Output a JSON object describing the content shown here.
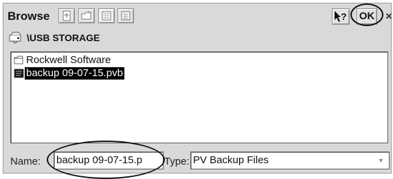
{
  "window": {
    "title": "Browse"
  },
  "toolbar": {
    "icons": [
      "document-up-icon",
      "folder-icon",
      "list-view-icon",
      "detail-view-icon"
    ],
    "help_label": "?",
    "ok_label": "OK",
    "close_label": "×"
  },
  "path": {
    "text": "\\USB STORAGE",
    "icon": "drive-icon"
  },
  "files": [
    {
      "label": "Rockwell Software",
      "icon": "folder-icon",
      "selected": false
    },
    {
      "label": "backup 09-07-15.pvb",
      "icon": "file-icon",
      "selected": true
    }
  ],
  "bottom": {
    "name_label": "Name:",
    "name_value": "backup 09-07-15.p",
    "type_label": "Type:",
    "type_value": "PV Backup Files"
  }
}
